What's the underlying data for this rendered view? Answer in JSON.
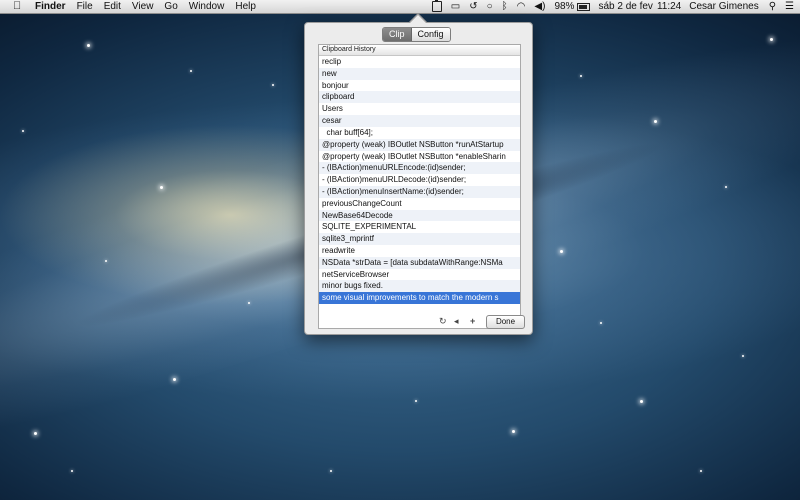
{
  "menubar": {
    "app_name": "Finder",
    "menus": [
      "File",
      "Edit",
      "View",
      "Go",
      "Window",
      "Help"
    ],
    "icons": [
      "apple-icon",
      "clipboard-icon",
      "airplay-icon",
      "time-machine-icon",
      "chat-icon",
      "bluetooth-icon",
      "wifi-icon",
      "volume-icon",
      "battery-icon",
      "search-icon",
      "list-icon"
    ],
    "battery_percent": "98%",
    "date": "sáb 2 de fev",
    "time": "11:24",
    "user": "Cesar Gimenes"
  },
  "popover": {
    "tabs": [
      {
        "label": "Clip",
        "active": true
      },
      {
        "label": "Config",
        "active": false
      }
    ],
    "list_header": "Clipboard History",
    "items": [
      "reclip",
      "new",
      "bonjour",
      "clipboard",
      "Users",
      "cesar",
      "  char buff[64];",
      "@property (weak) IBOutlet NSButton *runAtStartup",
      "@property (weak) IBOutlet NSButton *enableSharin",
      "- (IBAction)menuURLEncode:(id)sender;",
      "- (IBAction)menuURLDecode:(id)sender;",
      "- (IBAction)menuInsertName:(id)sender;",
      "previousChangeCount",
      "NewBase64Decode",
      "SQLITE_EXPERIMENTAL",
      "sqlite3_mprintf",
      "readwrite",
      "NSData *strData = [data subdataWithRange:NSMa",
      "netServiceBrowser",
      "minor bugs fixed.",
      "some visual improvements to match the modern s"
    ],
    "selected_index": 20,
    "toolbar": {
      "refresh_glyph": "↻",
      "prev_glyph": "◂",
      "add_glyph": "+",
      "done_label": "Done"
    }
  }
}
